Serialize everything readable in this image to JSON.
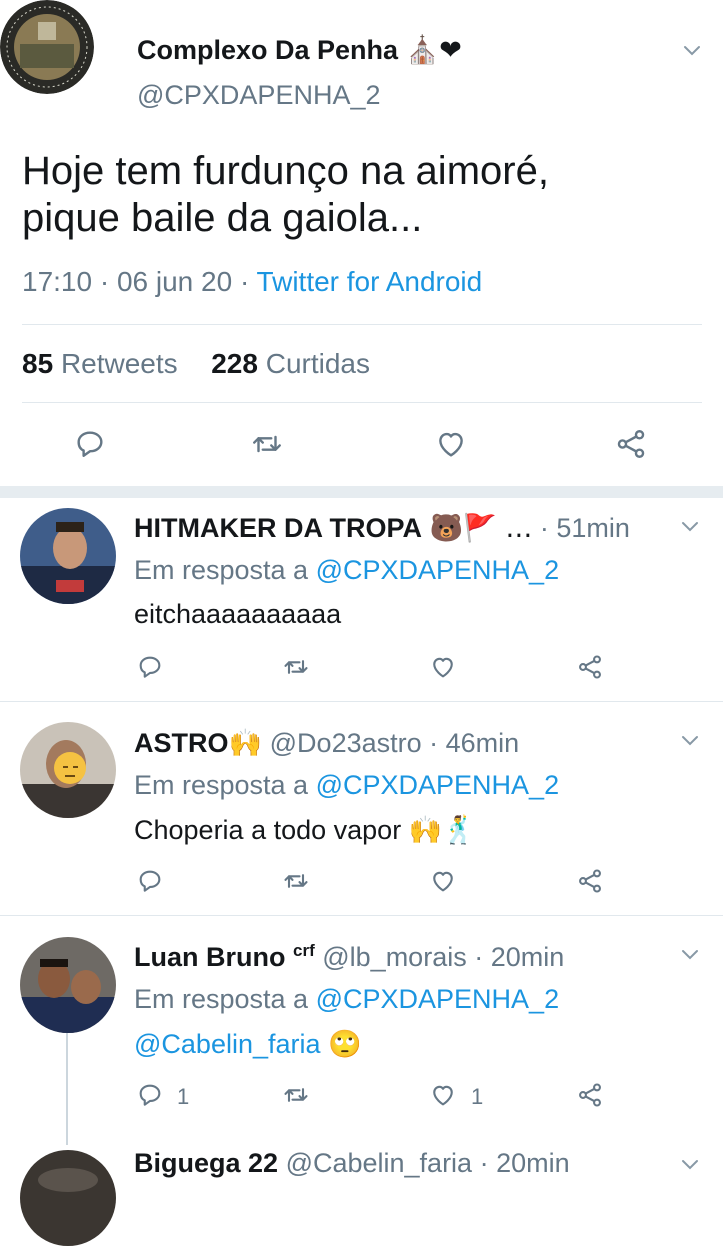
{
  "main_tweet": {
    "name": "Complexo Da Penha",
    "name_emojis": "⛪❤",
    "handle": "@CPXDAPENHA_2",
    "text_line1": "Hoje tem furdunço na aimoré,",
    "text_line2": "pique baile da gaiola...",
    "time": "17:10 · 06 jun 20 · ",
    "source": "Twitter for Android",
    "retweets_count": "85",
    "retweets_label": "Retweets",
    "likes_count": "228",
    "likes_label": "Curtidas"
  },
  "replies": [
    {
      "name": "HITMAKER DA TROPA",
      "name_suffix": "🐻🚩 …",
      "handle": "",
      "time": "· 51min",
      "reply_prefix": "Em resposta a",
      "reply_to": "@CPXDAPENHA_2",
      "text": "eitchaaaaaaaaaa",
      "reply_count": "",
      "like_count": ""
    },
    {
      "name": "ASTRO",
      "name_suffix": "🙌",
      "handle": "@Do23astro",
      "time": "· 46min",
      "reply_prefix": "Em resposta a",
      "reply_to": "@CPXDAPENHA_2",
      "text": "Choperia a todo vapor",
      "text_emoji": "🙌🕺",
      "reply_count": "",
      "like_count": ""
    },
    {
      "name": "Luan Bruno",
      "name_suffix": "crf",
      "handle": "@lb_morais",
      "time": "· 20min",
      "reply_prefix": "Em resposta a",
      "reply_to": "@CPXDAPENHA_2",
      "text": "@Cabelin_faria",
      "text_emoji": "🙄",
      "reply_count": "1",
      "like_count": "1"
    },
    {
      "name": "Biguega 22",
      "name_suffix": "",
      "handle": "@Cabelin_faria",
      "time": "· 20min"
    }
  ],
  "icons": {
    "reply": "reply-icon",
    "retweet": "retweet-icon",
    "like": "heart-icon",
    "share": "share-icon",
    "more": "chevron-down-icon"
  },
  "colors": {
    "link_blue": "#1b95e0",
    "secondary_grey": "#657786",
    "separator": "#e6ecf0"
  }
}
